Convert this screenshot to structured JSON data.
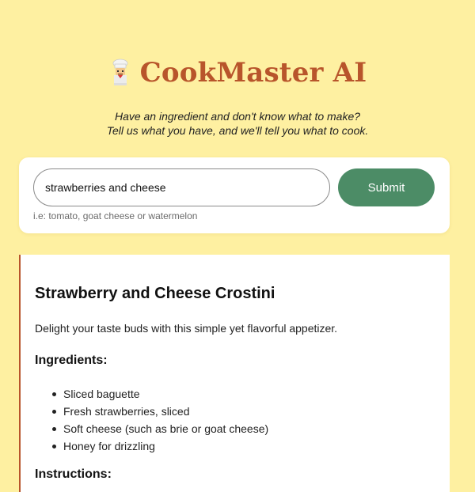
{
  "header": {
    "icon": "chef-icon",
    "title": "CookMaster AI"
  },
  "tagline": {
    "line1": "Have an ingredient and don't know what to make?",
    "line2": "Tell us what you have, and we'll tell you what to cook."
  },
  "search": {
    "value": "strawberries and cheese",
    "submit_label": "Submit",
    "hint": "i.e: tomato, goat cheese or watermelon"
  },
  "recipe": {
    "title": "Strawberry and Cheese Crostini",
    "description": "Delight your taste buds with this simple yet flavorful appetizer.",
    "ingredients_heading": "Ingredients:",
    "ingredients": [
      "Sliced baguette",
      "Fresh strawberries, sliced",
      "Soft cheese (such as brie or goat cheese)",
      "Honey for drizzling"
    ],
    "next_heading": "Instructions:"
  },
  "colors": {
    "background": "#fef0a1",
    "title": "#b8552b",
    "submit": "#4c8c66"
  }
}
